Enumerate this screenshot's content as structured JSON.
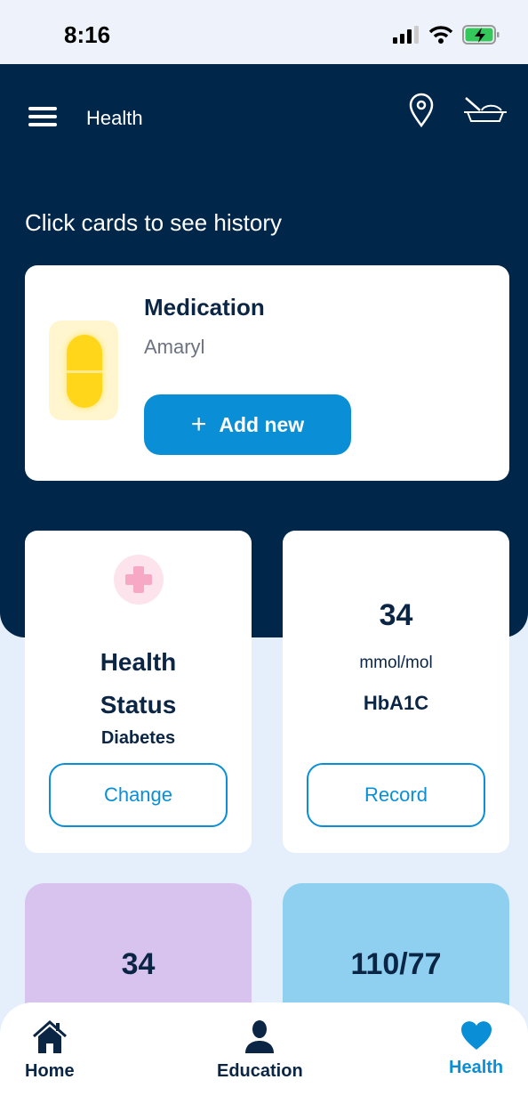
{
  "status_bar": {
    "time": "8:16",
    "battery_color": "#34c759"
  },
  "header": {
    "title": "Health",
    "menu_icon": "hamburger-icon",
    "location_icon": "map-pin-icon",
    "food_icon": "food-bowl-icon"
  },
  "hint": "Click cards to see history",
  "medication": {
    "title": "Medication",
    "name": "Amaryl",
    "add_label": "Add new",
    "icon": "pill-icon"
  },
  "health_status": {
    "title_line1": "Health",
    "title_line2": "Status",
    "condition": "Diabetes",
    "button": "Change"
  },
  "hba1c": {
    "value": "34",
    "unit": "mmol/mol",
    "label": "HbA1C",
    "button": "Record"
  },
  "tiles": [
    {
      "value": "34",
      "color": "#d8c3ee"
    },
    {
      "value": "110/77",
      "color": "#8fcff0"
    }
  ],
  "nav": {
    "items": [
      {
        "label": "Home",
        "active": false
      },
      {
        "label": "Education",
        "active": false
      },
      {
        "label": "Health",
        "active": true
      }
    ],
    "active_color": "#0a8fd6"
  },
  "colors": {
    "navy": "#00264a",
    "accent": "#0a8fd6"
  }
}
